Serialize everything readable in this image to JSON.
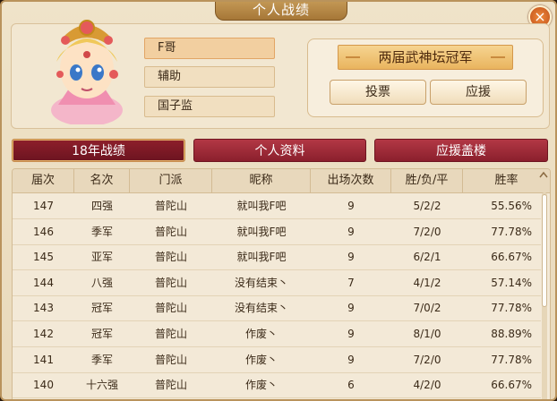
{
  "window": {
    "title": "个人战绩",
    "close_icon": "×"
  },
  "profile": {
    "name": "F哥",
    "role": "辅助",
    "school": "国子监",
    "honor_title": "两届武神坛冠军",
    "vote_label": "投票",
    "support_label": "应援"
  },
  "tabs": [
    {
      "label": "18年战绩",
      "active": true
    },
    {
      "label": "个人资料",
      "active": false
    },
    {
      "label": "应援盖楼",
      "active": false
    }
  ],
  "table": {
    "headers": [
      "届次",
      "名次",
      "门派",
      "昵称",
      "出场次数",
      "胜/负/平",
      "胜率"
    ],
    "rows": [
      [
        "147",
        "四强",
        "普陀山",
        "就叫我F吧",
        "9",
        "5/2/2",
        "55.56%"
      ],
      [
        "146",
        "季军",
        "普陀山",
        "就叫我F吧",
        "9",
        "7/2/0",
        "77.78%"
      ],
      [
        "145",
        "亚军",
        "普陀山",
        "就叫我F吧",
        "9",
        "6/2/1",
        "66.67%"
      ],
      [
        "144",
        "八强",
        "普陀山",
        "没有结束丶",
        "7",
        "4/1/2",
        "57.14%"
      ],
      [
        "143",
        "冠军",
        "普陀山",
        "没有结束丶",
        "9",
        "7/0/2",
        "77.78%"
      ],
      [
        "142",
        "冠军",
        "普陀山",
        "作废丶",
        "9",
        "8/1/0",
        "88.89%"
      ],
      [
        "141",
        "季军",
        "普陀山",
        "作废丶",
        "9",
        "7/2/0",
        "77.78%"
      ],
      [
        "140",
        "十六强",
        "普陀山",
        "作废丶",
        "6",
        "4/2/0",
        "66.67%"
      ]
    ]
  },
  "colors": {
    "accent": "#8b1f2d",
    "panel": "#f3e9d7",
    "gold": "#e9b45e"
  }
}
